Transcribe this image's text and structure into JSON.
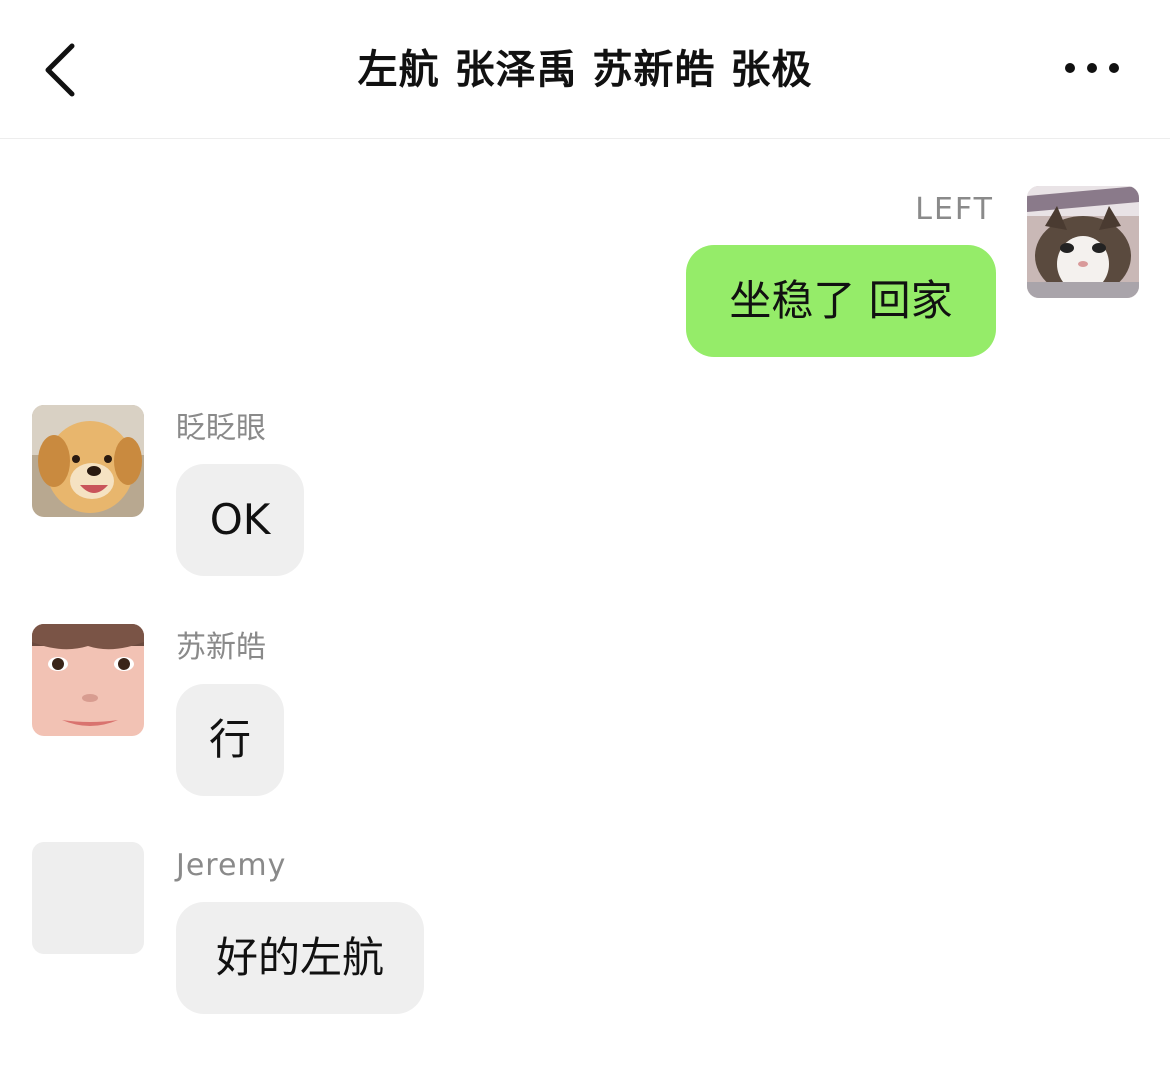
{
  "header": {
    "title": "左航 张泽禹 苏新皓 张极",
    "back_icon": "chevron-left-icon",
    "more_icon": "ellipsis-icon"
  },
  "colors": {
    "outgoing_bubble": "#95ec69",
    "incoming_bubble": "#efefef",
    "sender_name": "#8a8a8a"
  },
  "messages": [
    {
      "sender": "LEFT",
      "text": "坐稳了 回家",
      "direction": "outgoing",
      "avatar": "cat-avatar"
    },
    {
      "sender": "眨眨眼",
      "text": "OK",
      "direction": "incoming",
      "avatar": "puppy-avatar"
    },
    {
      "sender": "苏新皓",
      "text": "行",
      "direction": "incoming",
      "avatar": "face-avatar"
    },
    {
      "sender": "Jeremy",
      "text": "好的左航",
      "direction": "incoming",
      "avatar": "blank-avatar"
    }
  ]
}
